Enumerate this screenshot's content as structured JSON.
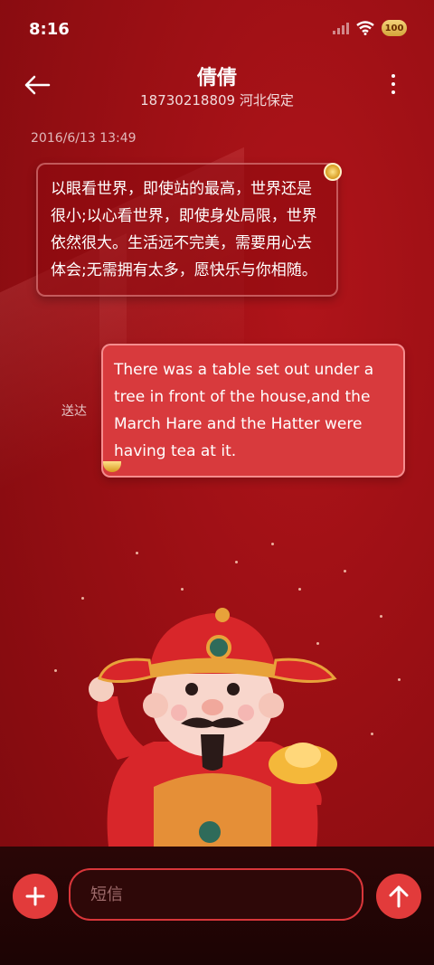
{
  "status_bar": {
    "time": "8:16",
    "battery": "100",
    "icons": [
      "signal-icon",
      "wifi-icon",
      "battery-icon"
    ]
  },
  "header": {
    "contact_name": "倩倩",
    "contact_sub": "18730218809 河北保定",
    "icons": [
      "back-arrow-icon",
      "more-icon"
    ]
  },
  "conversation": {
    "timestamp": "2016/6/13 13:49",
    "incoming_message": "以眼看世界，即使站的最高，世界还是很小;以心看世界，即使身处局限，世界依然很大。生活远不完美，需要用心去体会;无需拥有太多，愿快乐与你相随。",
    "outgoing_status": "送达",
    "outgoing_message": "There was a table set out under a tree in front of the house,and the March Hare and the Hatter were having tea at it."
  },
  "composer": {
    "placeholder": "短信",
    "icons": [
      "plus-icon",
      "send-arrow-icon"
    ]
  },
  "colors": {
    "background": "#9a0f14",
    "accent": "#e23b3b",
    "outgoing_bubble": "#d83a3d",
    "input_border": "#d9363a"
  }
}
